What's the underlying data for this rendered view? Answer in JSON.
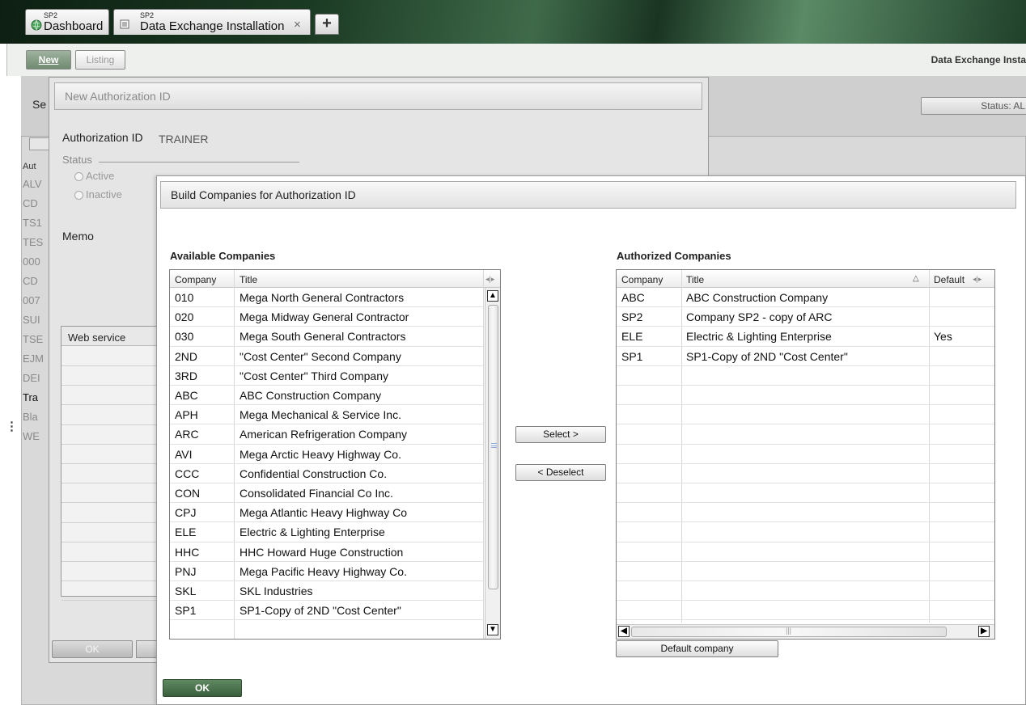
{
  "tabs": [
    {
      "small": "SP2",
      "label": "Dashboard",
      "icon": "dashboard-globe-icon"
    },
    {
      "small": "SP2",
      "label": "Data Exchange Installation",
      "icon": "document-icon",
      "close": "×"
    }
  ],
  "new_tab": "+",
  "toolbar": {
    "new_label": "New",
    "listing_label": "Listing",
    "app_title": "Data Exchange Insta"
  },
  "background": {
    "heading": "Se",
    "status": "Status: AL",
    "codes": [
      "Aut",
      "ALV",
      "CD",
      "TS1",
      "TES",
      "000",
      "CD",
      "007",
      "SUI",
      "TSE",
      "EJM",
      "DEI",
      "Tra",
      "Bla",
      "WE"
    ]
  },
  "dialog1": {
    "title": "New Authorization ID",
    "auth_label": "Authorization ID",
    "auth_value": "TRAINER",
    "status_label": "Status",
    "active_label": "Active",
    "inactive_label": "Inactive",
    "memo_label": "Memo",
    "webservice_label": "Web service",
    "ok_label": "OK"
  },
  "dialog2": {
    "title": "Build Companies for Authorization ID",
    "available_title": "Available Companies",
    "authorized_title": "Authorized Companies",
    "available_columns": [
      "Company",
      "Title"
    ],
    "authorized_columns": [
      "Company",
      "Title",
      "Default"
    ],
    "available": [
      [
        "010",
        "Mega North General Contractors"
      ],
      [
        "020",
        "Mega Midway General Contractor"
      ],
      [
        "030",
        "Mega South General Contractors"
      ],
      [
        "2ND",
        "\"Cost Center\" Second Company"
      ],
      [
        "3RD",
        "\"Cost Center\" Third Company"
      ],
      [
        "ABC",
        "ABC Construction Company"
      ],
      [
        "APH",
        "Mega Mechanical & Service Inc."
      ],
      [
        "ARC",
        "American Refrigeration Company"
      ],
      [
        "AVI",
        "Mega Arctic Heavy Highway Co."
      ],
      [
        "CCC",
        "Confidential Construction Co."
      ],
      [
        "CON",
        "Consolidated Financial Co Inc."
      ],
      [
        "CPJ",
        "Mega Atlantic Heavy Highway Co"
      ],
      [
        "ELE",
        "Electric & Lighting Enterprise"
      ],
      [
        "HHC",
        "HHC Howard Huge Construction"
      ],
      [
        "PNJ",
        "Mega Pacific Heavy Highway Co."
      ],
      [
        "SKL",
        "SKL Industries"
      ],
      [
        "SP1",
        "SP1-Copy of 2ND \"Cost Center\""
      ]
    ],
    "authorized": [
      [
        "ABC",
        "ABC Construction Company",
        ""
      ],
      [
        "SP2",
        "Company SP2 - copy of ARC",
        ""
      ],
      [
        "ELE",
        "Electric & Lighting Enterprise",
        "Yes"
      ],
      [
        "SP1",
        "SP1-Copy of 2ND \"Cost Center\"",
        ""
      ]
    ],
    "select_label": "Select >",
    "deselect_label": "< Deselect",
    "default_company_label": "Default company",
    "ok_label": "OK"
  }
}
